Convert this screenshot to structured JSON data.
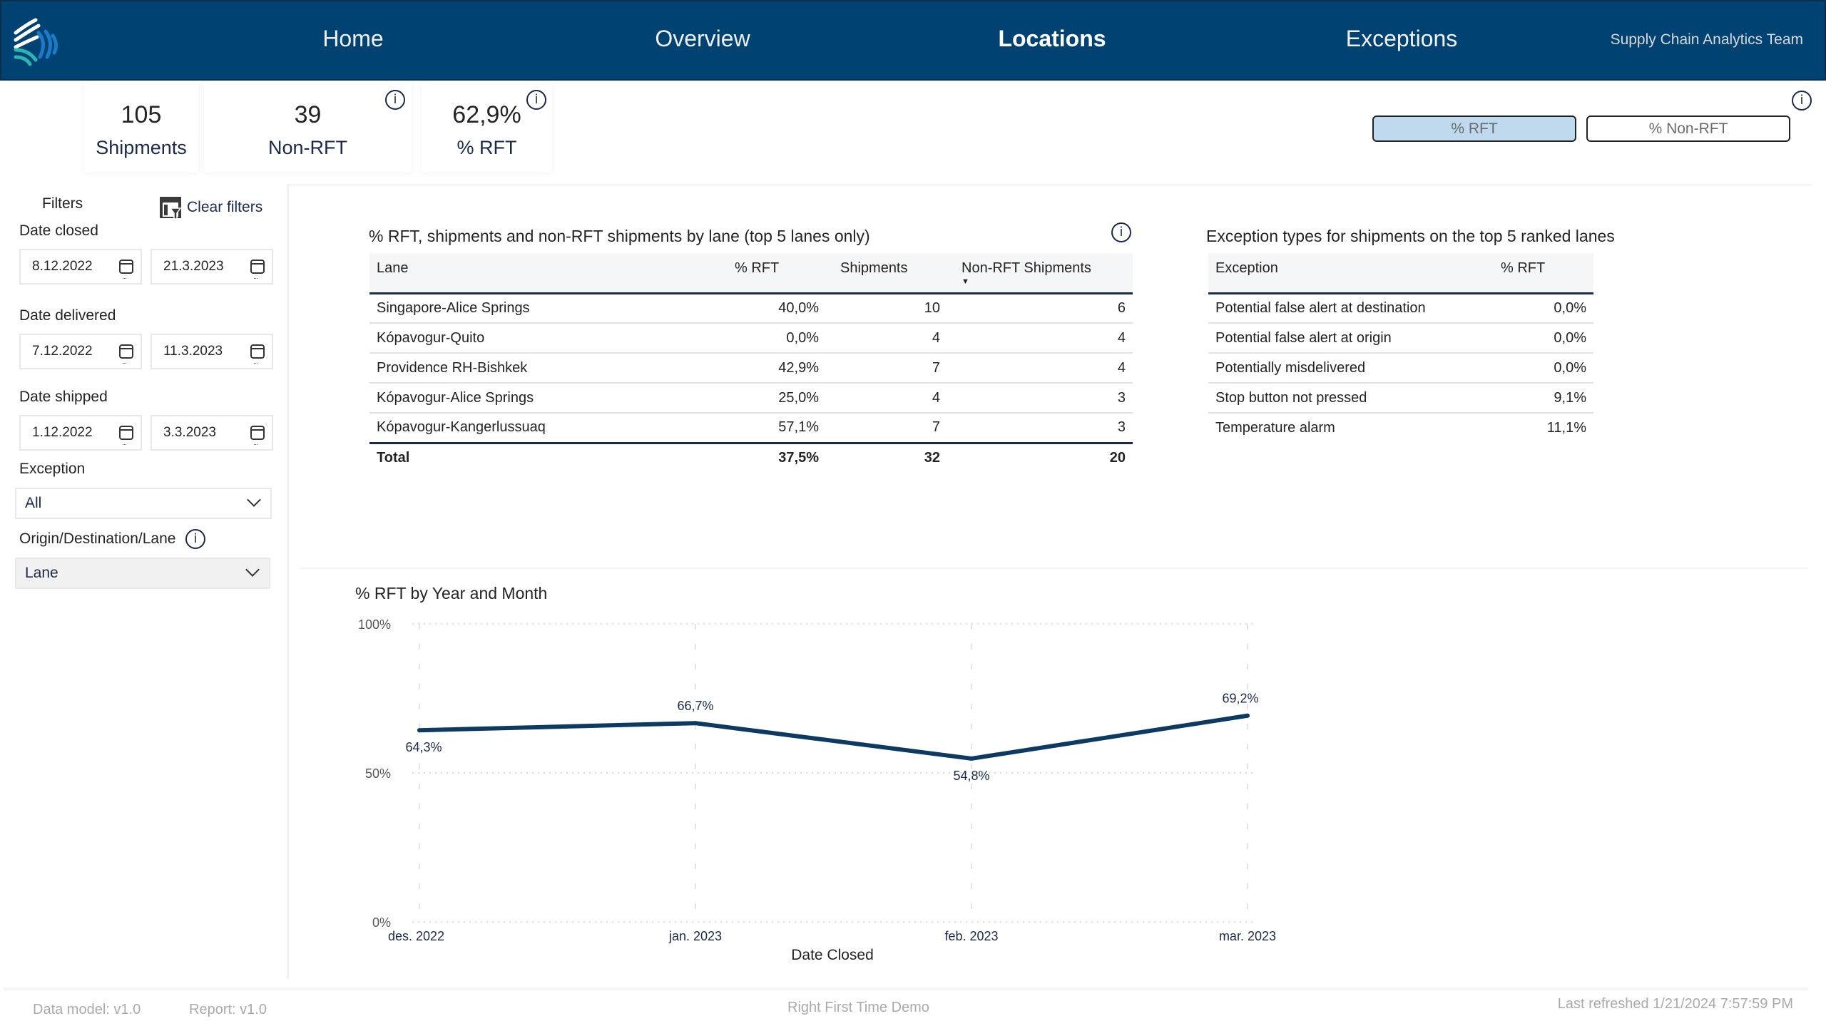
{
  "header": {
    "logo_icon": "wave-logo-icon",
    "nav": [
      {
        "label": "Home",
        "active": false
      },
      {
        "label": "Overview",
        "active": false
      },
      {
        "label": "Locations",
        "active": true
      },
      {
        "label": "Exceptions",
        "active": false
      }
    ],
    "team": "Supply Chain Analytics Team"
  },
  "kpis": [
    {
      "value": "105",
      "label": "Shipments",
      "info": false
    },
    {
      "value": "39",
      "label": "Non-RFT",
      "info": true
    },
    {
      "value": "62,9%",
      "label": "% RFT",
      "info": true
    }
  ],
  "info_glyph": "i",
  "toggle": {
    "options": [
      "% RFT",
      "% Non-RFT"
    ],
    "selected": "% RFT"
  },
  "filters": {
    "title": "Filters",
    "clear_label": "Clear filters",
    "clear_icon": "clear-filter-icon",
    "date_closed": {
      "label": "Date closed",
      "from": "8.12.2022",
      "to": "21.3.2023"
    },
    "date_delivered": {
      "label": "Date delivered",
      "from": "7.12.2022",
      "to": "11.3.2023"
    },
    "date_shipped": {
      "label": "Date shipped",
      "from": "1.12.2022",
      "to": "3.3.2023"
    },
    "exception": {
      "label": "Exception",
      "value": "All"
    },
    "odl": {
      "label": "Origin/Destination/Lane",
      "value": "Lane"
    }
  },
  "lane_table": {
    "title": "% RFT, shipments and non-RFT shipments by lane (top 5 lanes only)",
    "columns": [
      "Lane",
      "% RFT",
      "Shipments",
      "Non-RFT Shipments"
    ],
    "sorted_column": "Non-RFT Shipments",
    "sort_direction": "descending",
    "rows": [
      [
        "Singapore-Alice Springs",
        "40,0%",
        "10",
        "6"
      ],
      [
        "Kópavogur-Quito",
        "0,0%",
        "4",
        "4"
      ],
      [
        "Providence RH-Bishkek",
        "42,9%",
        "7",
        "4"
      ],
      [
        "Kópavogur-Alice Springs",
        "25,0%",
        "4",
        "3"
      ],
      [
        "Kópavogur-Kangerlussuaq",
        "57,1%",
        "7",
        "3"
      ]
    ],
    "total": [
      "Total",
      "37,5%",
      "32",
      "20"
    ]
  },
  "exception_table": {
    "title": "Exception types for shipments on the top 5 ranked lanes",
    "columns": [
      "Exception",
      "% RFT"
    ],
    "rows": [
      [
        "Potential false alert at destination",
        "0,0%"
      ],
      [
        "Potential false alert at origin",
        "0,0%"
      ],
      [
        "Potentially misdelivered",
        "0,0%"
      ],
      [
        "Stop button not pressed",
        "9,1%"
      ],
      [
        "Temperature alarm",
        "11,1%"
      ]
    ]
  },
  "chart_data": {
    "type": "line",
    "title": "% RFT by Year and Month",
    "xlabel": "Date Closed",
    "ylabel": "",
    "categories": [
      "des. 2022",
      "jan. 2023",
      "feb. 2023",
      "mar. 2023"
    ],
    "series": [
      {
        "name": "% RFT",
        "values": [
          64.3,
          66.7,
          54.8,
          69.2
        ],
        "labels": [
          "64,3%",
          "66,7%",
          "54,8%",
          "69,2%"
        ],
        "color": "#0d3a63"
      }
    ],
    "ylim": [
      0,
      100
    ],
    "yticks": [
      {
        "value": 0,
        "label": "0%"
      },
      {
        "value": 50,
        "label": "50%"
      },
      {
        "value": 100,
        "label": "100%"
      }
    ],
    "grid": true,
    "legend": "none"
  },
  "footer": {
    "data_model": "Data model: v1.0",
    "report": "Report: v1.0",
    "title": "Right First Time Demo",
    "refreshed": "Last refreshed 1/21/2024 7:57:59 PM"
  }
}
